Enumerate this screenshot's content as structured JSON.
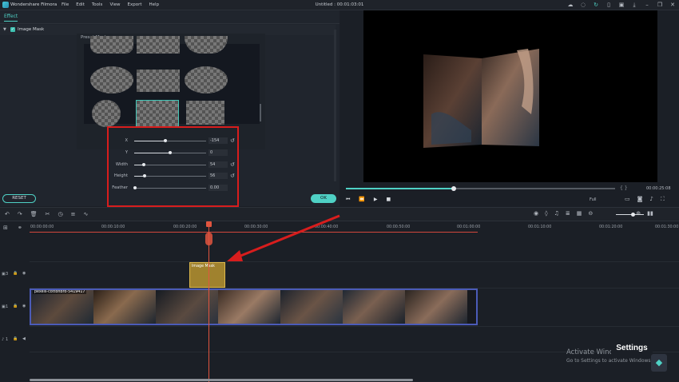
{
  "app": {
    "name": "Wondershare Filmora",
    "window_title": "Untitled : 00:01:03:01",
    "menu": [
      "File",
      "Edit",
      "Tools",
      "View",
      "Export",
      "Help"
    ]
  },
  "left_panel": {
    "tab": "Effect",
    "effect_name": "Image Mask",
    "preset_label": "Preset Mask",
    "params": [
      {
        "label": "X",
        "value": "-154",
        "level": 0.43
      },
      {
        "label": "Y",
        "value": "0",
        "level": 0.5
      },
      {
        "label": "Width",
        "value": "54",
        "level": 0.14
      },
      {
        "label": "Height",
        "value": "56",
        "level": 0.15
      },
      {
        "label": "Feather",
        "value": "0.00",
        "level": 0.0
      }
    ],
    "reset_label": "RESET",
    "ok_label": "OK"
  },
  "preview": {
    "time": "00:00:25:08",
    "brackets": "{   }",
    "quality": "Full",
    "progress": 0.4
  },
  "ruler": {
    "ticks": [
      "00:00:00:00",
      "00:00:10:00",
      "00:00:20:00",
      "00:00:30:00",
      "00:00:40:00",
      "00:00:50:00",
      "00:01:00:00",
      "00:01:10:00",
      "00:01:20:00",
      "00:01:30:00"
    ]
  },
  "timeline": {
    "track_labels": [
      "3",
      "1",
      "1"
    ],
    "mask_clip_label": "Image Mask",
    "video_clip_label": "pexels-cottonbro-5419417"
  },
  "overlay": {
    "activate_title": "Activate Windows",
    "activate_sub": "Go to Settings to activate Windows.",
    "settings_popup": "Settings"
  },
  "colors": {
    "accent": "#4fd1c5",
    "highlight_box": "#d81d1d",
    "playhead": "#e2553f",
    "video_clip_border": "#4b5bb8",
    "mask_clip": "#a0822e"
  }
}
